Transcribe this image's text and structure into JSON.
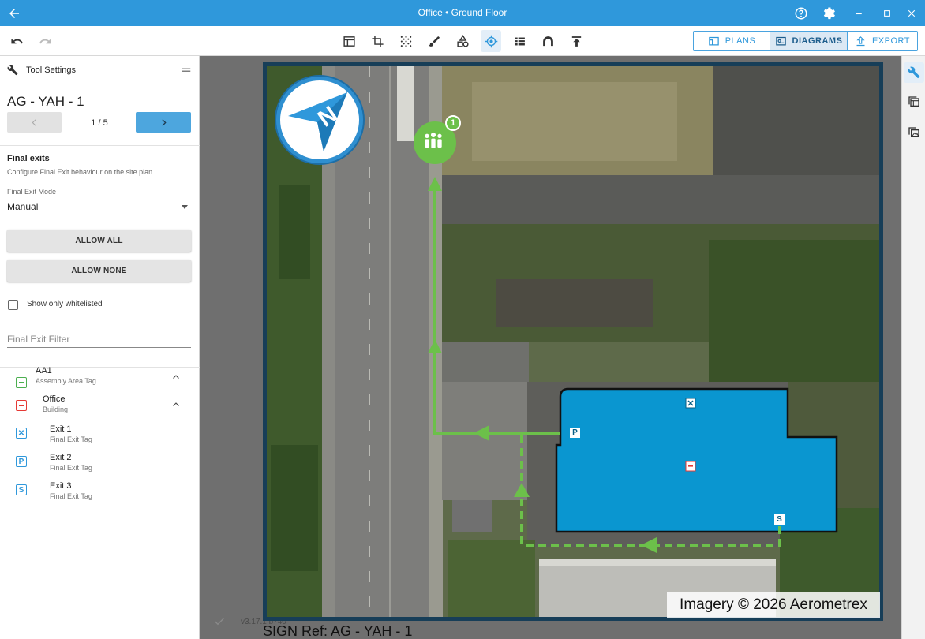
{
  "window": {
    "title": "Office • Ground Floor"
  },
  "tabs": {
    "plans_label": "PLANS",
    "diagrams_label": "DIAGRAMS",
    "export_label": "EXPORT"
  },
  "panel": {
    "header_label": "Tool Settings",
    "identifier": "AG - YAH - 1",
    "pager": "1 / 5",
    "section_title": "Final exits",
    "section_desc": "Configure Final Exit behaviour on the site plan.",
    "mode_label": "Final Exit Mode",
    "mode_value": "Manual",
    "allow_all_label": "ALLOW ALL",
    "allow_none_label": "ALLOW NONE",
    "whitelist_label": "Show only whitelisted",
    "filter_placeholder": "Final Exit Filter",
    "tree": [
      {
        "name": "AA1",
        "sub": "Assembly Area Tag",
        "icon": "assembly-tag-icon",
        "color": "#4caf50"
      },
      {
        "name": "Office",
        "sub": "Building",
        "icon": "building-tag-icon",
        "color": "#e53935"
      },
      {
        "name": "Exit 1",
        "sub": "Final Exit Tag",
        "icon": "exit-x-icon",
        "glyph": "✕",
        "color": "#2f98db"
      },
      {
        "name": "Exit 2",
        "sub": "Final Exit Tag",
        "icon": "exit-p-icon",
        "glyph": "P",
        "color": "#2f98db"
      },
      {
        "name": "Exit 3",
        "sub": "Final Exit Tag",
        "icon": "exit-s-icon",
        "glyph": "S",
        "color": "#2f98db"
      }
    ]
  },
  "canvas": {
    "attribution": "Imagery © 2026 Aerometrex",
    "sign_ref": "SIGN Ref: AG - YAH - 1",
    "assembly_badge_count": "1",
    "exit_markers": [
      "P",
      "S"
    ],
    "version": "v3.17.1 b740"
  },
  "colors": {
    "titlebar": "#2f98db",
    "building": "#0a96d0",
    "route": "#6cc04a"
  }
}
